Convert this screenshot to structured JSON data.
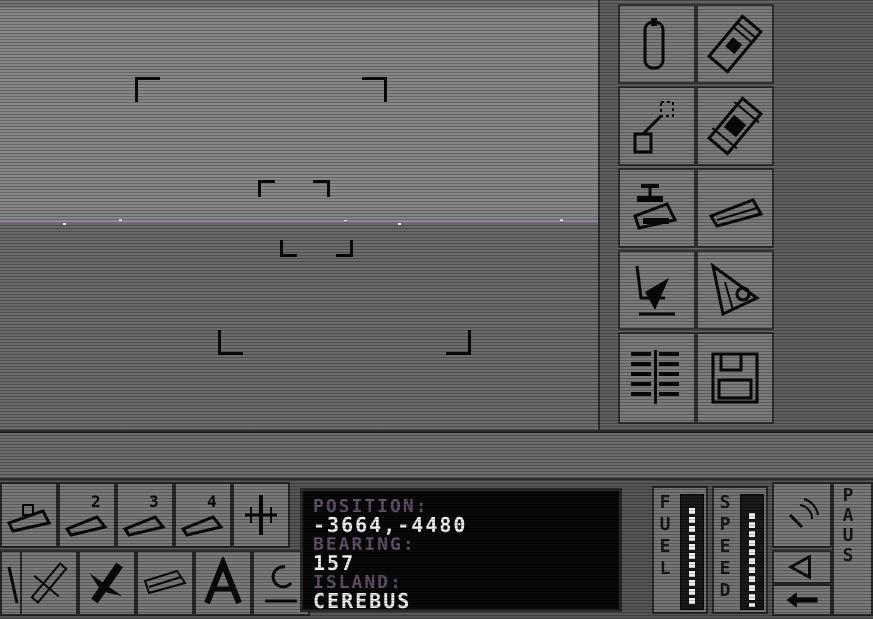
{
  "info": {
    "position_label": "POSITION:",
    "position_value": "-3664,-4480",
    "bearing_label": "BEARING:",
    "bearing_value": "157",
    "island_label": "ISLAND:",
    "island_value": "CEREBUS"
  },
  "gauges": {
    "fuel_label": "FUEL",
    "fuel_level": 0.9,
    "speed_label": "SPEED",
    "speed_level": 0.85
  },
  "pause_label": "PAUS",
  "vehicle_slots": [
    "2",
    "3",
    "4"
  ],
  "colors": {
    "sky": "#818181",
    "sea": "#646464",
    "horizon": "#9a7fa3",
    "info_label": "#5b4a63",
    "info_value": "#f0f0f0"
  },
  "icons": {
    "side_panel": [
      "walrus-vehicle-icon",
      "missile-pod-icon",
      "periscope-icon",
      "damaged-pod-icon",
      "drone-launcher-icon",
      "boat-outline-icon",
      "radar-dish-icon",
      "laser-cannon-icon",
      "tally-map-icon",
      "floppy-disk-icon"
    ],
    "bottom_left": [
      "carrier-icon",
      "walrus-slot-2-icon",
      "walrus-slot-3-icon",
      "walrus-slot-4-icon",
      "manta-slot-icon",
      "quadrant-icon",
      "aircraft-icon",
      "manta-aircraft-icon",
      "walrus-outline-icon",
      "autopilot-a-icon",
      "repair-icon"
    ],
    "bottom_right": [
      "radio-signal-icon",
      "speaker-icon",
      "arrow-back-icon"
    ]
  }
}
